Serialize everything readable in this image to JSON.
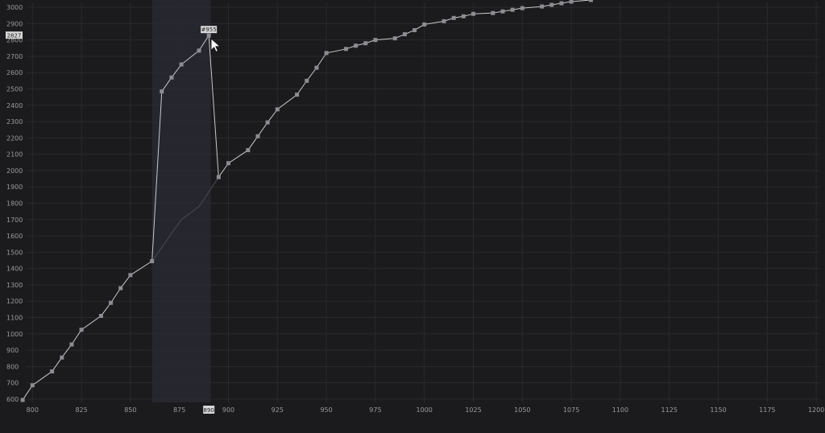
{
  "chart_data": {
    "type": "line",
    "title": "",
    "xlabel": "",
    "ylabel": "",
    "xlim": [
      797,
      1202
    ],
    "ylim": [
      580,
      3030
    ],
    "grid": true,
    "x_ticks": [
      800,
      825,
      850,
      875,
      900,
      925,
      950,
      975,
      1000,
      1025,
      1050,
      1075,
      1100,
      1125,
      1150,
      1175,
      1200
    ],
    "y_ticks": [
      600,
      700,
      800,
      900,
      1000,
      1100,
      1200,
      1300,
      1400,
      1500,
      1600,
      1700,
      1800,
      1900,
      2000,
      2100,
      2200,
      2300,
      2400,
      2500,
      2600,
      2700,
      2800,
      2900,
      3000
    ],
    "highlight_range": [
      861,
      891
    ],
    "hover": {
      "x_value": "890",
      "y_value": "2827",
      "point_label": "#955"
    },
    "series": [
      {
        "points": [
          [
            795,
            595
          ],
          [
            800,
            685
          ],
          [
            810,
            770
          ],
          [
            815,
            855
          ],
          [
            820,
            935
          ],
          [
            825,
            1025
          ],
          [
            835,
            1110
          ],
          [
            840,
            1190
          ],
          [
            845,
            1280
          ],
          [
            850,
            1360
          ],
          [
            861,
            1445
          ],
          [
            866,
            2485
          ],
          [
            871,
            2570
          ],
          [
            876,
            2650
          ],
          [
            885,
            2735
          ],
          [
            890,
            2827
          ],
          [
            895,
            1960
          ],
          [
            900,
            2045
          ],
          [
            910,
            2125
          ],
          [
            915,
            2210
          ],
          [
            920,
            2295
          ],
          [
            925,
            2375
          ],
          [
            935,
            2465
          ],
          [
            940,
            2550
          ],
          [
            945,
            2630
          ],
          [
            950,
            2720
          ],
          [
            960,
            2745
          ],
          [
            965,
            2765
          ],
          [
            970,
            2780
          ],
          [
            975,
            2800
          ],
          [
            985,
            2810
          ],
          [
            990,
            2835
          ],
          [
            995,
            2860
          ],
          [
            1000,
            2895
          ],
          [
            1010,
            2915
          ],
          [
            1015,
            2935
          ],
          [
            1020,
            2945
          ],
          [
            1025,
            2960
          ],
          [
            1035,
            2965
          ],
          [
            1040,
            2975
          ],
          [
            1045,
            2985
          ],
          [
            1050,
            2995
          ],
          [
            1060,
            3005
          ],
          [
            1065,
            3015
          ],
          [
            1070,
            3025
          ],
          [
            1075,
            3035
          ],
          [
            1085,
            3045
          ]
        ]
      },
      {
        "style": "ghost",
        "points": [
          [
            861,
            1445
          ],
          [
            876,
            1700
          ],
          [
            885,
            1780
          ],
          [
            895,
            1960
          ]
        ]
      }
    ]
  },
  "colors": {
    "background": "#1b1b1d",
    "grid": "#2a2a2e",
    "line": "#c9c9cc",
    "marker": "#8c8c92",
    "highlight": "#26262f",
    "tick_text": "#9a9aa0"
  }
}
